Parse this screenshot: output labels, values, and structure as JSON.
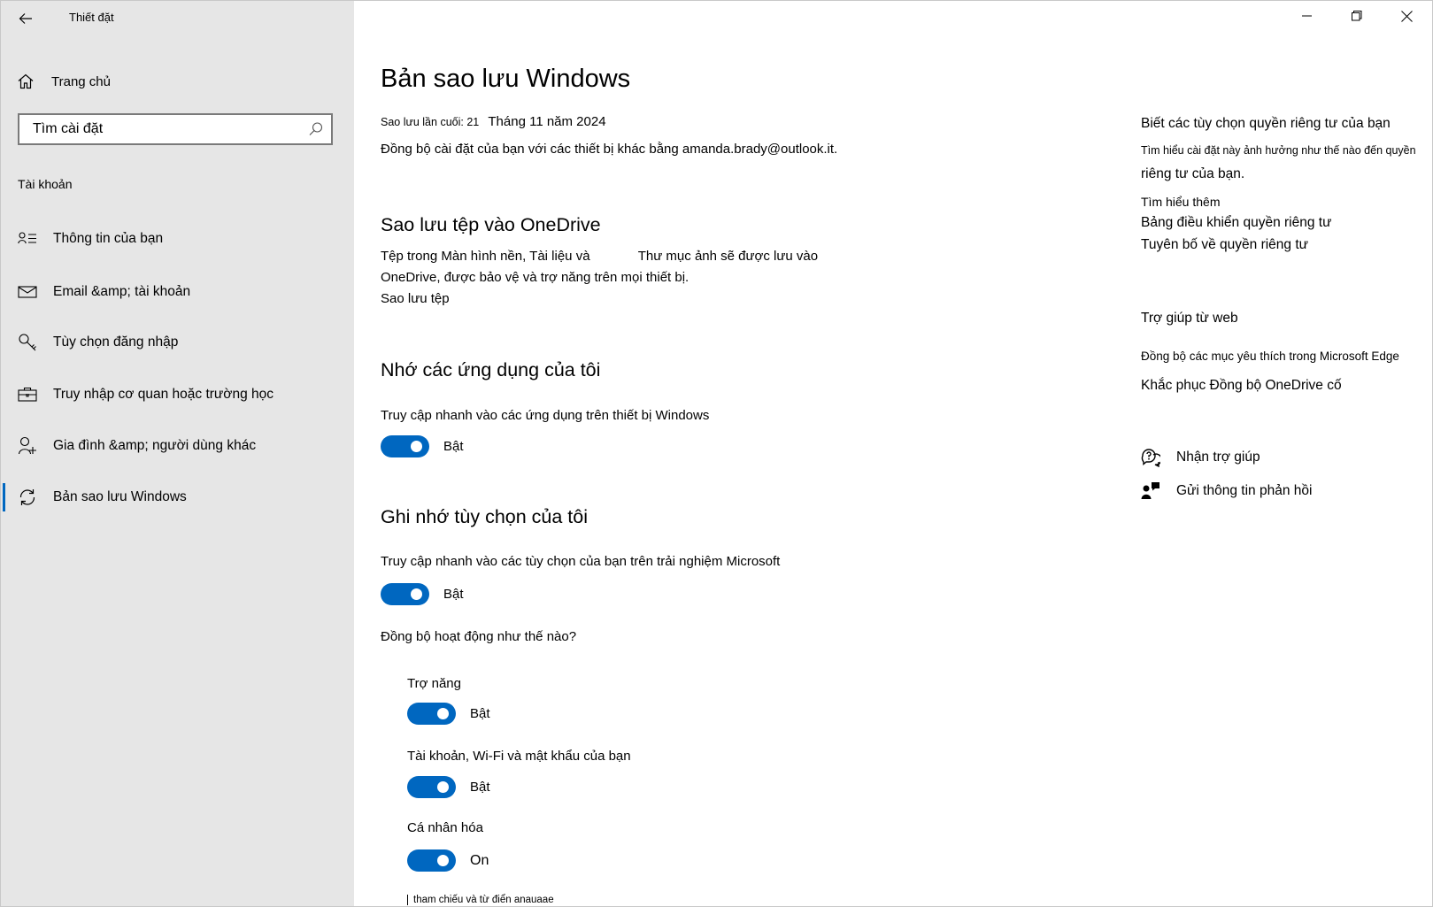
{
  "window": {
    "title": "Thiết đặt"
  },
  "sidebar": {
    "home_label": "Trang chủ",
    "search_placeholder": "Tìm cài đặt",
    "section_label": "Tài khoản",
    "items": [
      {
        "label": "Thông tin của bạn",
        "icon": "person-card-icon"
      },
      {
        "label": "Email &amp; tài khoản",
        "icon": "mail-icon"
      },
      {
        "label": "Tùy chọn đăng nhập",
        "icon": "key-icon"
      },
      {
        "label": "Truy nhập cơ quan hoặc trường học",
        "icon": "briefcase-icon"
      },
      {
        "label": "Gia đình &amp; người dùng khác",
        "icon": "person-add-icon"
      },
      {
        "label": "Bản sao lưu Windows",
        "icon": "sync-icon",
        "active": true
      }
    ]
  },
  "main": {
    "title": "Bản sao lưu Windows",
    "last_backup_label": "Sao lưu lần cuối: 21",
    "last_backup_date": "Tháng 11 năm 2024",
    "sync_description": "Đồng bộ cài đặt của bạn với các thiết bị khác bằng amanda.brady@outlook.it.",
    "onedrive": {
      "heading": "Sao lưu tệp vào OneDrive",
      "line1a": "Tệp trong Màn hình nền, Tài liệu và",
      "line1b": "Thư mục ảnh sẽ được lưu vào",
      "line2": "OneDrive, được bảo vệ và trợ năng trên mọi thiết bị.",
      "link": "Sao lưu tệp"
    },
    "apps": {
      "heading": "Nhớ các ứng dụng của tôi",
      "description": "Truy cập nhanh vào các ứng dụng trên thiết bị Windows",
      "toggle_label": "Bật",
      "on": true
    },
    "prefs": {
      "heading": "Ghi nhớ tùy chọn của tôi",
      "description": "Truy cập nhanh vào các tùy chọn của bạn trên trải nghiệm Microsoft",
      "toggle_label": "Bật",
      "on": true,
      "how_link": "Đồng bộ hoạt động như thế nào?",
      "sub_items": [
        {
          "label": "Trợ năng",
          "toggle_label": "Bật",
          "on": true
        },
        {
          "label": "Tài khoản, Wi-Fi và mật khẩu của bạn",
          "toggle_label": "Bật",
          "on": true
        },
        {
          "label": "Cá nhân hóa",
          "toggle_label": "On",
          "on": true
        }
      ],
      "cut_off_text": "tham chiếu và từ điển anauaae"
    }
  },
  "right": {
    "privacy_heading": "Biết các tùy chọn quyền riêng tư của bạn",
    "privacy_desc1": "Tìm hiểu cài đặt này ảnh hưởng như thế nào đến quyền",
    "privacy_desc2": "riêng tư của bạn.",
    "learn_more": "Tìm hiểu thêm",
    "privacy_dashboard": "Bảng điều khiển quyền riêng tư",
    "privacy_statement": "Tuyên bố về quyền riêng tư",
    "web_help_heading": "Trợ giúp từ web",
    "edge_sync": "Đồng bộ các mục yêu thích trong Microsoft Edge",
    "onedrive_fix": "Khắc phục Đồng bộ OneDrive cố",
    "get_help": "Nhận trợ giúp",
    "feedback": "Gửi thông tin phản hồi"
  },
  "colors": {
    "accent": "#0067c0",
    "sidebar_bg": "#e6e6e6"
  }
}
